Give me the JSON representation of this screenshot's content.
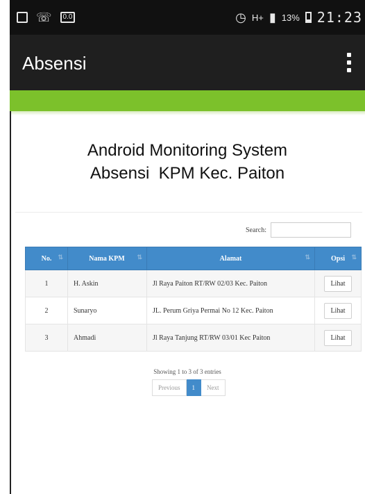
{
  "status_bar": {
    "chip": "0.0",
    "network": "H+",
    "battery": "13%",
    "time": "21:23"
  },
  "app_bar": {
    "title": "Absensi",
    "menu_icon": "overflow-menu-icon"
  },
  "page": {
    "heading_line1": "Android Monitoring System",
    "heading_line2": "Absensi  KPM Kec. Paiton"
  },
  "search": {
    "label": "Search:",
    "value": ""
  },
  "table": {
    "columns": [
      "No.",
      "Nama KPM",
      "Alamat",
      "Opsi"
    ],
    "rows": [
      {
        "no": "1",
        "nama": "H. Askin",
        "alamat": "Jl Raya Paiton RT/RW 02/03 Kec. Paiton",
        "opsi": "Lihat"
      },
      {
        "no": "2",
        "nama": "Sunaryo",
        "alamat": "JL. Perum Griya Permai No 12 Kec. Paiton",
        "opsi": "Lihat"
      },
      {
        "no": "3",
        "nama": "Ahmadi",
        "alamat": "Jl Raya Tanjung RT/RW 03/01 Kec Paiton",
        "opsi": "Lihat"
      }
    ]
  },
  "footer": {
    "info": "Showing 1 to 3 of 3 entries",
    "prev": "Previous",
    "page": "1",
    "next": "Next"
  },
  "colors": {
    "accent": "#7cc12b",
    "header": "#428bca",
    "appbar": "#1f1f1f"
  }
}
